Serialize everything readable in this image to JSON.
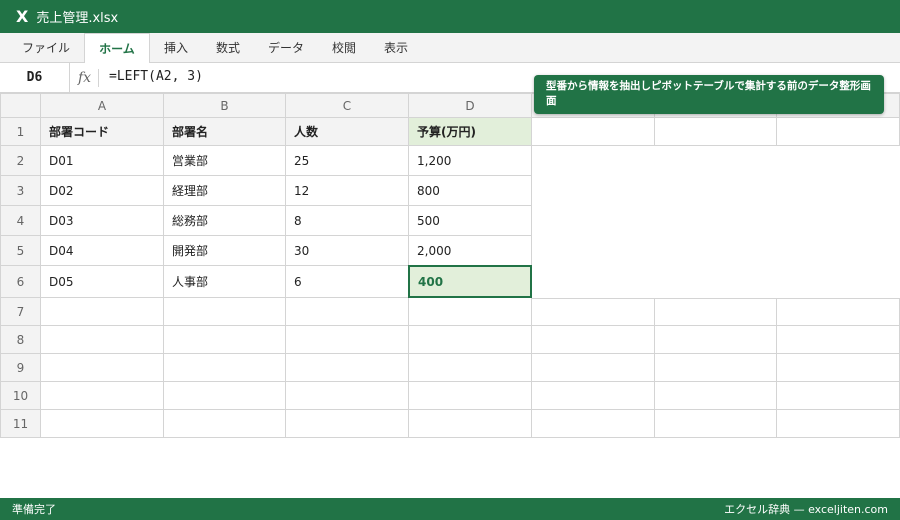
{
  "window": {
    "icon": "excel-icon",
    "logo_glyph": "X",
    "title": "売上管理.xlsx"
  },
  "ribbon": {
    "tabs": [
      {
        "label": "ファイル",
        "active": false
      },
      {
        "label": "ホーム",
        "active": true
      },
      {
        "label": "挿入",
        "active": false
      },
      {
        "label": "数式",
        "active": false
      },
      {
        "label": "データ",
        "active": false
      },
      {
        "label": "校閲",
        "active": false
      },
      {
        "label": "表示",
        "active": false
      }
    ]
  },
  "formula_bar": {
    "name_box": "D6",
    "fx_label": "fx",
    "formula": "=LEFT(A2, 3)"
  },
  "callout": {
    "text": "型番から情報を抽出しピボットテーブルで集計する前のデータ整形画面"
  },
  "sheet": {
    "columns": [
      "A",
      "B",
      "C",
      "D",
      "",
      "",
      ""
    ],
    "rows": [
      "1",
      "2",
      "3",
      "4",
      "5",
      "6",
      "7",
      "8",
      "9",
      "10",
      "11"
    ],
    "header_row": [
      "部署コード",
      "部署名",
      "人数",
      "予算(万円)"
    ],
    "data_rows": [
      [
        "D01",
        "営業部",
        "25",
        "1,200"
      ],
      [
        "D02",
        "経理部",
        "12",
        "800"
      ],
      [
        "D03",
        "総務部",
        "8",
        "500"
      ],
      [
        "D04",
        "開発部",
        "30",
        "2,000"
      ],
      [
        "D05",
        "人事部",
        "6",
        "400"
      ]
    ],
    "selected_cell": "D6"
  },
  "status_bar": {
    "left": "準備完了",
    "right": "エクセル辞典 — exceljiten.com"
  },
  "colors": {
    "accent": "#217346",
    "highlight": "#e2efda"
  }
}
